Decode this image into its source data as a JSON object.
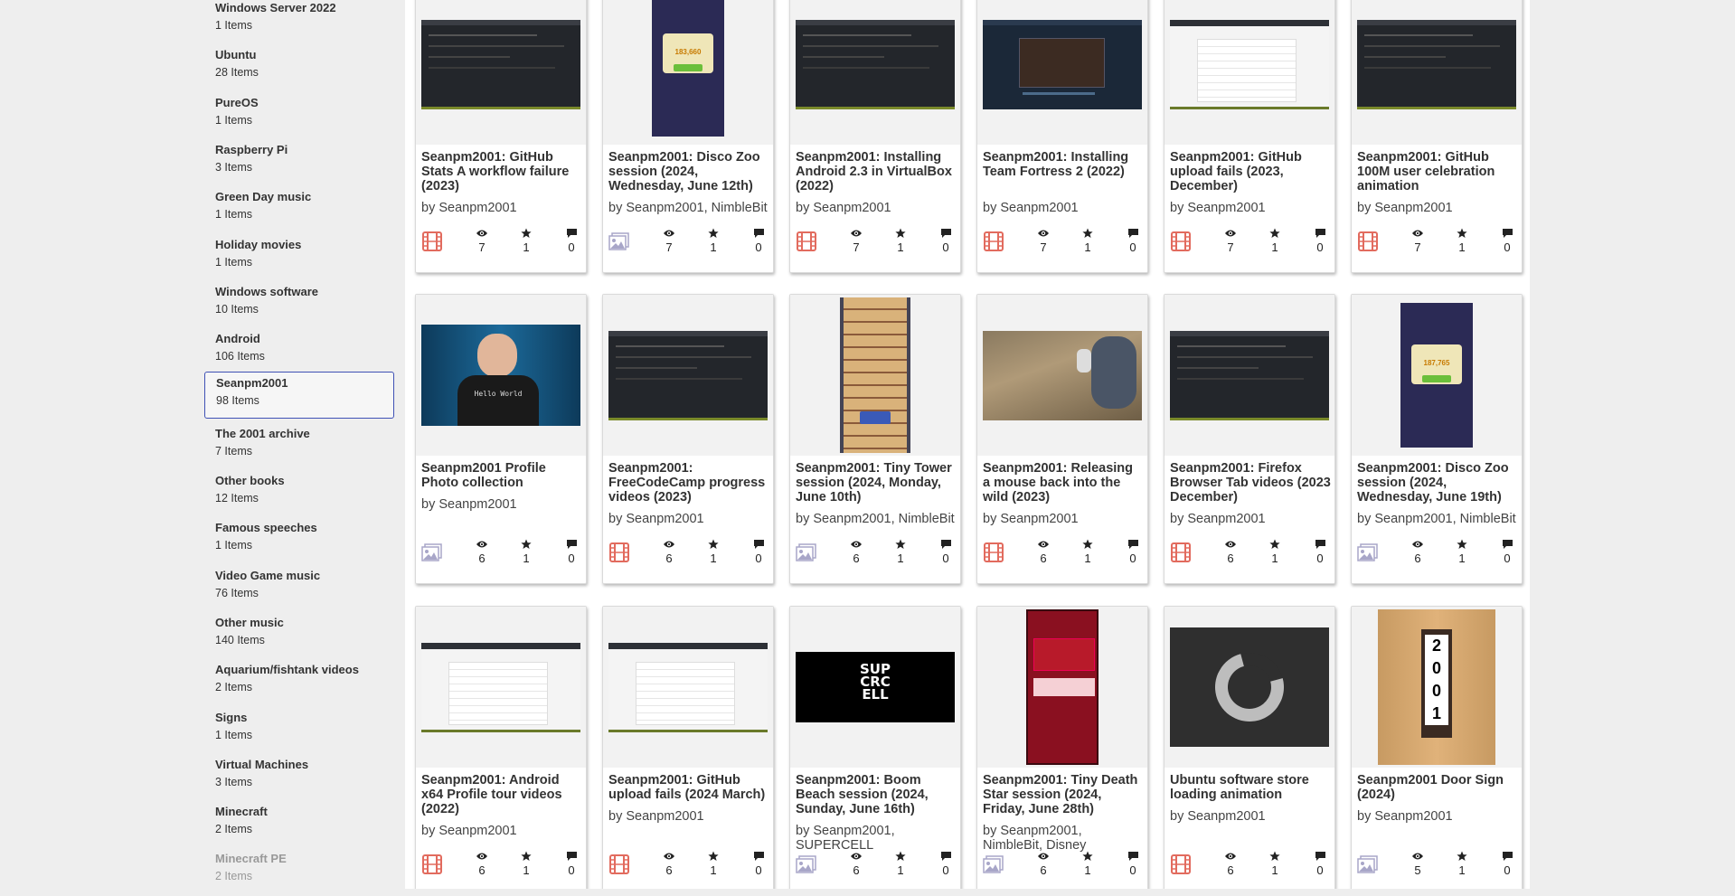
{
  "sidebar": {
    "collections": [
      {
        "name": "Windows Server 2022",
        "count": "1 Items"
      },
      {
        "name": "Ubuntu",
        "count": "28 Items"
      },
      {
        "name": "PureOS",
        "count": "1 Items"
      },
      {
        "name": "Raspberry Pi",
        "count": "3 Items"
      },
      {
        "name": "Green Day music",
        "count": "1 Items"
      },
      {
        "name": "Holiday movies",
        "count": "1 Items"
      },
      {
        "name": "Windows software",
        "count": "10 Items"
      },
      {
        "name": "Android",
        "count": "106 Items"
      },
      {
        "name": "Seanpm2001",
        "count": "98 Items",
        "selected": true
      },
      {
        "name": "The 2001 archive",
        "count": "7 Items"
      },
      {
        "name": "Other books",
        "count": "12 Items"
      },
      {
        "name": "Famous speeches",
        "count": "1 Items"
      },
      {
        "name": "Video Game music",
        "count": "76 Items"
      },
      {
        "name": "Other music",
        "count": "140 Items"
      },
      {
        "name": "Aquarium/fishtank videos",
        "count": "2 Items"
      },
      {
        "name": "Signs",
        "count": "1 Items"
      },
      {
        "name": "Virtual Machines",
        "count": "3 Items"
      },
      {
        "name": "Minecraft",
        "count": "2 Items"
      },
      {
        "name": "Minecraft PE",
        "count": "2 Items"
      }
    ]
  },
  "items": [
    {
      "title": "Seanpm2001: GitHub Stats A workflow failure (2023)",
      "creator": "by Seanpm2001",
      "mediatype": "movies",
      "views": "7",
      "favorites": "1",
      "reviews": "0",
      "thumb": "dark-screen"
    },
    {
      "title": "Seanpm2001: Disco Zoo session (2024, Wednesday, June 12th)",
      "creator": "by Seanpm2001, NimbleBit",
      "mediatype": "image",
      "views": "7",
      "favorites": "1",
      "reviews": "0",
      "thumb": "phone-game-dark",
      "thumb_text": "183,660"
    },
    {
      "title": "Seanpm2001: Installing Android 2.3 in VirtualBox (2022)",
      "creator": "by Seanpm2001",
      "mediatype": "movies",
      "views": "7",
      "favorites": "1",
      "reviews": "0",
      "thumb": "dark-screen"
    },
    {
      "title": "Seanpm2001: Installing Team Fortress 2 (2022)",
      "creator": "by Seanpm2001",
      "mediatype": "movies",
      "views": "7",
      "favorites": "1",
      "reviews": "0",
      "thumb": "steam-page"
    },
    {
      "title": "Seanpm2001: GitHub upload fails (2023, December)",
      "creator": "by Seanpm2001",
      "mediatype": "movies",
      "views": "7",
      "favorites": "1",
      "reviews": "0",
      "thumb": "light-screen"
    },
    {
      "title": "Seanpm2001: GitHub 100M user celebration animation",
      "creator": "by Seanpm2001",
      "mediatype": "movies",
      "views": "7",
      "favorites": "1",
      "reviews": "0",
      "thumb": "dark-screen"
    },
    {
      "title": "Seanpm2001 Profile Photo collection",
      "creator": "by Seanpm2001",
      "mediatype": "image",
      "views": "6",
      "favorites": "1",
      "reviews": "0",
      "thumb": "person-photo",
      "thumb_text": "Hello World"
    },
    {
      "title": "Seanpm2001: FreeCodeCamp progress videos (2023)",
      "creator": "by Seanpm2001",
      "mediatype": "movies",
      "views": "6",
      "favorites": "1",
      "reviews": "0",
      "thumb": "dark-screen"
    },
    {
      "title": "Seanpm2001: Tiny Tower session (2024, Monday, June 10th)",
      "creator": "by Seanpm2001, NimbleBit",
      "mediatype": "image",
      "views": "6",
      "favorites": "1",
      "reviews": "0",
      "thumb": "tower-game"
    },
    {
      "title": "Seanpm2001: Releasing a mouse back into the wild (2023)",
      "creator": "by Seanpm2001",
      "mediatype": "movies",
      "views": "6",
      "favorites": "1",
      "reviews": "0",
      "thumb": "outdoor-photo"
    },
    {
      "title": "Seanpm2001: Firefox Browser Tab videos (2023 December)",
      "creator": "by Seanpm2001",
      "mediatype": "movies",
      "views": "6",
      "favorites": "1",
      "reviews": "0",
      "thumb": "dark-screen"
    },
    {
      "title": "Seanpm2001: Disco Zoo session (2024, Wednesday, June 19th)",
      "creator": "by Seanpm2001, NimbleBit",
      "mediatype": "image",
      "views": "6",
      "favorites": "1",
      "reviews": "0",
      "thumb": "phone-game-dark",
      "thumb_text": "187,765"
    },
    {
      "title": "Seanpm2001: Android x64 Profile tour videos (2022)",
      "creator": "by Seanpm2001",
      "mediatype": "movies",
      "views": "6",
      "favorites": "1",
      "reviews": "0",
      "thumb": "light-screen"
    },
    {
      "title": "Seanpm2001: GitHub upload fails (2024 March)",
      "creator": "by Seanpm2001",
      "mediatype": "movies",
      "views": "6",
      "favorites": "1",
      "reviews": "0",
      "thumb": "light-screen"
    },
    {
      "title": "Seanpm2001: Boom Beach session (2024, Sunday, June 16th)",
      "creator": "by Seanpm2001, SUPERCELL",
      "mediatype": "image",
      "views": "6",
      "favorites": "1",
      "reviews": "0",
      "thumb": "logo-dark",
      "thumb_text": "SUP CRC ELL"
    },
    {
      "title": "Seanpm2001: Tiny Death Star session (2024, Friday, June 28th)",
      "creator": "by Seanpm2001, NimbleBit, Disney",
      "mediatype": "image",
      "views": "6",
      "favorites": "1",
      "reviews": "0",
      "thumb": "phone-game-red"
    },
    {
      "title": "Ubuntu software store loading animation",
      "creator": "by Seanpm2001",
      "mediatype": "movies",
      "views": "6",
      "favorites": "1",
      "reviews": "0",
      "thumb": "spinner"
    },
    {
      "title": "Seanpm2001 Door Sign (2024)",
      "creator": "by Seanpm2001",
      "mediatype": "image",
      "views": "5",
      "favorites": "1",
      "reviews": "0",
      "thumb": "sign-photo",
      "thumb_text": "2001"
    }
  ],
  "colors": {
    "accent": "#3f51b5",
    "mediatype_icon": "#e26b5e",
    "image_icon": "#a8a6c8"
  },
  "icons": {
    "views": "eye-icon",
    "favorites": "star-icon",
    "reviews": "comment-icon"
  }
}
